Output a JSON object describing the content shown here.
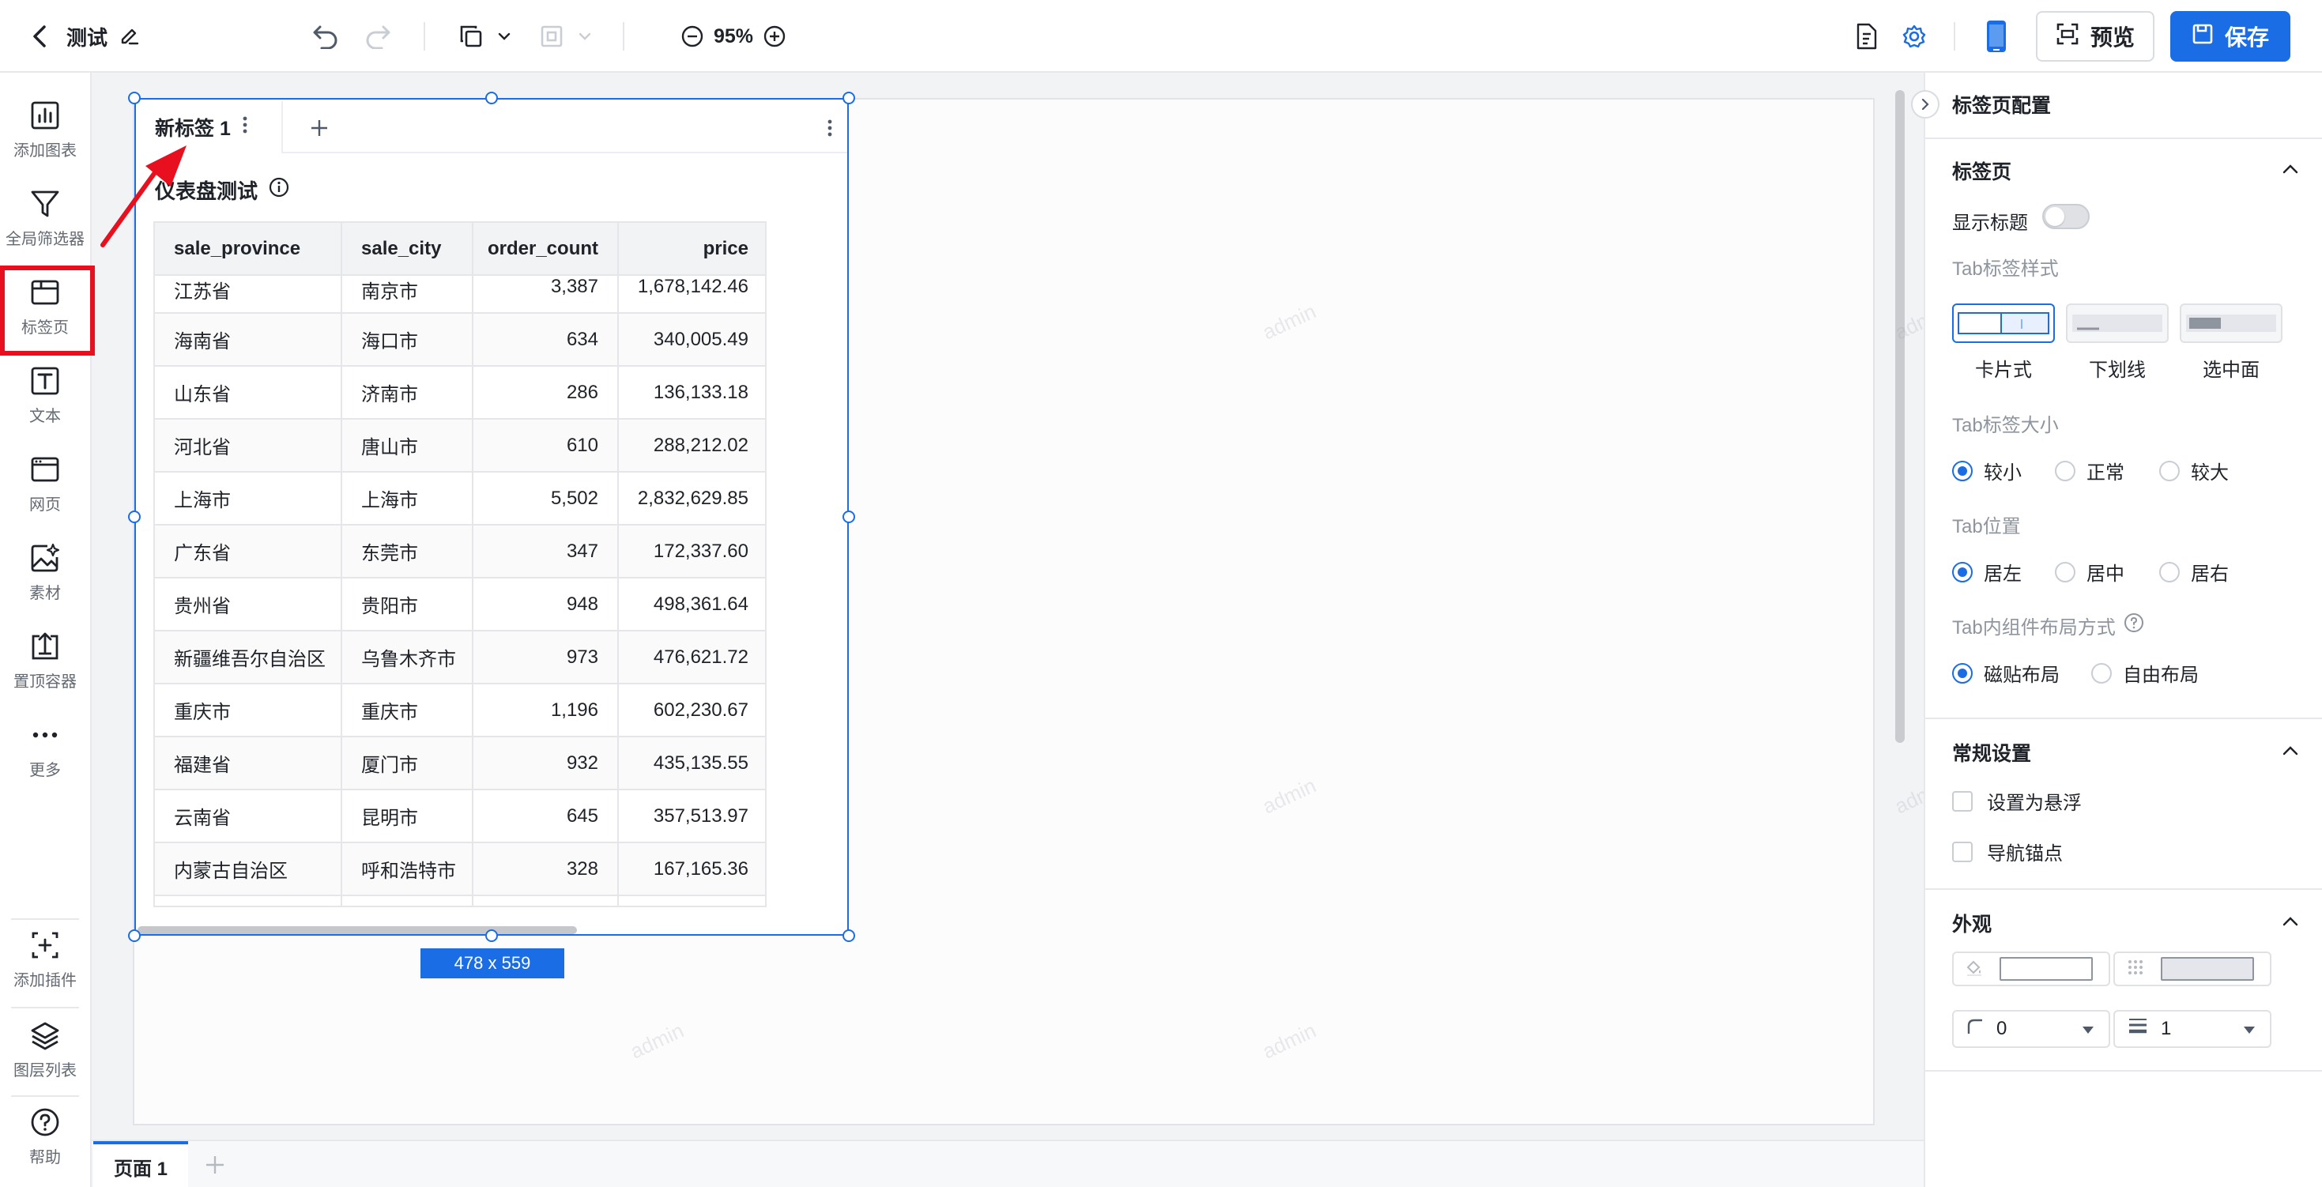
{
  "header": {
    "title": "测试",
    "zoom": "95%",
    "preview_label": "预览",
    "save_label": "保存",
    "accent_color": "#1a6de4"
  },
  "leftbar": {
    "items": [
      {
        "label": "添加图表",
        "icon": "bar-chart-icon"
      },
      {
        "label": "全局筛选器",
        "icon": "filter-icon"
      },
      {
        "label": "标签页",
        "icon": "tab-page-icon"
      },
      {
        "label": "文本",
        "icon": "text-icon"
      },
      {
        "label": "网页",
        "icon": "webpage-icon"
      },
      {
        "label": "素材",
        "icon": "image-icon"
      },
      {
        "label": "置顶容器",
        "icon": "pin-top-icon"
      },
      {
        "label": "更多",
        "icon": "more-icon"
      }
    ],
    "bottom_items": [
      {
        "label": "添加插件",
        "icon": "add-plugin-icon"
      },
      {
        "label": "图层列表",
        "icon": "layers-icon"
      },
      {
        "label": "帮助",
        "icon": "help-icon"
      }
    ]
  },
  "widget": {
    "tab_label": "新标签 1",
    "chart_title": "仪表盘测试",
    "size_label": "478 x 559",
    "table": {
      "columns": [
        "sale_province",
        "sale_city",
        "order_count",
        "price"
      ],
      "rows": [
        [
          "江苏省",
          "南京市",
          "3,387",
          "1,678,142.46"
        ],
        [
          "海南省",
          "海口市",
          "634",
          "340,005.49"
        ],
        [
          "山东省",
          "济南市",
          "286",
          "136,133.18"
        ],
        [
          "河北省",
          "唐山市",
          "610",
          "288,212.02"
        ],
        [
          "上海市",
          "上海市",
          "5,502",
          "2,832,629.85"
        ],
        [
          "广东省",
          "东莞市",
          "347",
          "172,337.60"
        ],
        [
          "贵州省",
          "贵阳市",
          "948",
          "498,361.64"
        ],
        [
          "新疆维吾尔自治区",
          "乌鲁木齐市",
          "973",
          "476,621.72"
        ],
        [
          "重庆市",
          "重庆市",
          "1,196",
          "602,230.67"
        ],
        [
          "福建省",
          "厦门市",
          "932",
          "435,135.55"
        ],
        [
          "云南省",
          "昆明市",
          "645",
          "357,513.97"
        ],
        [
          "内蒙古自治区",
          "呼和浩特市",
          "328",
          "167,165.36"
        ]
      ]
    }
  },
  "watermark_text": "admin",
  "bottombar": {
    "page_tab": "页面 1"
  },
  "rightpanel": {
    "title": "标签页配置",
    "tab_section": {
      "title": "标签页",
      "show_title_label": "显示标题",
      "show_title_on": false,
      "tab_style_label": "Tab标签样式",
      "tab_styles": [
        "卡片式",
        "下划线",
        "选中面"
      ],
      "tab_style_selected": "卡片式",
      "tab_size_label": "Tab标签大小",
      "tab_sizes": [
        "较小",
        "正常",
        "较大"
      ],
      "tab_size_selected": "较小",
      "tab_position_label": "Tab位置",
      "tab_positions": [
        "居左",
        "居中",
        "居右"
      ],
      "tab_position_selected": "居左",
      "layout_label": "Tab内组件布局方式",
      "layouts": [
        "磁贴布局",
        "自由布局"
      ],
      "layout_selected": "磁贴布局"
    },
    "general_section": {
      "title": "常规设置",
      "options": [
        "设置为悬浮",
        "导航锚点"
      ]
    },
    "appearance_section": {
      "title": "外观",
      "radius_value": "0",
      "border_value": "1"
    }
  }
}
